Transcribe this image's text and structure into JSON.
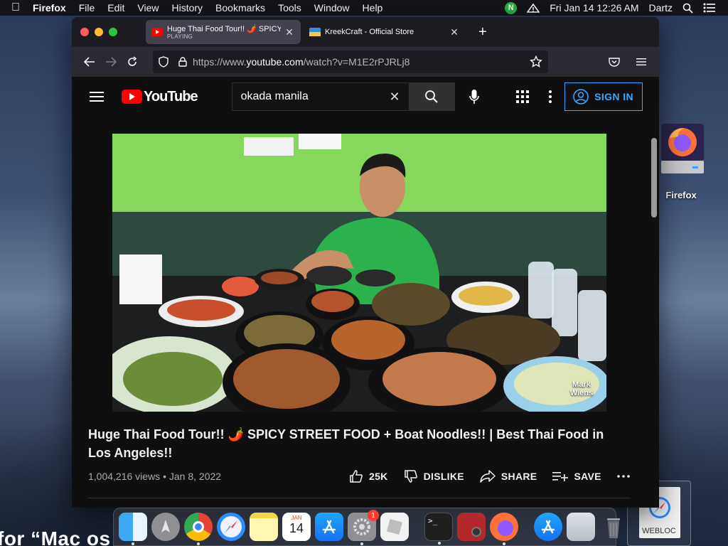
{
  "menubar": {
    "app_name": "Firefox",
    "items": [
      "File",
      "Edit",
      "View",
      "History",
      "Bookmarks",
      "Tools",
      "Window",
      "Help"
    ],
    "status_n": "N",
    "datetime": "Fri Jan 14  12:26 AM",
    "user": "Dartz"
  },
  "tabs": [
    {
      "title": "Huge Thai Food Tour!! 🌶️ SPICY STREET FOOD",
      "subtitle": "PLAYING"
    },
    {
      "title": "KreekCraft - Official Store"
    }
  ],
  "url": {
    "prefix": "https://www.",
    "domain": "youtube.com",
    "path": "/watch?v=M1E2rPJRLj8"
  },
  "youtube": {
    "logo_text": "YouTube",
    "search_query": "okada manila",
    "sign_in": "SIGN IN"
  },
  "video": {
    "watermark": "Mark Wiens",
    "title": "Huge Thai Food Tour!! 🌶️ SPICY STREET FOOD + Boat Noodles!! | Best Thai Food in Los Angeles!!",
    "views": "1,004,216 views",
    "date": "Jan 8, 2022",
    "likes": "25K",
    "dislike": "DISLIKE",
    "share": "SHARE",
    "save": "SAVE"
  },
  "desktop": {
    "firefox_label": "Firefox",
    "webloc_label": "WEBLOC",
    "peek_text": "for “Mac os"
  },
  "dock": {
    "calendar_month": "JAN",
    "calendar_day": "14",
    "settings_badge": "1"
  }
}
